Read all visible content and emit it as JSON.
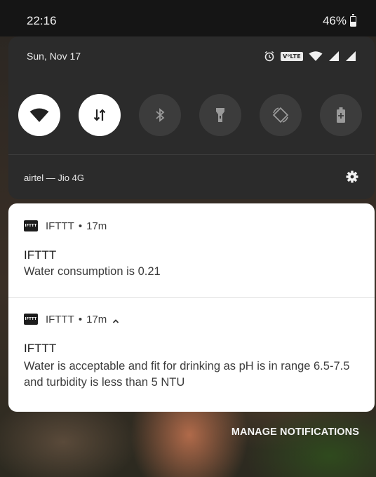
{
  "status_bar": {
    "time": "22:16",
    "battery_percent": "46%",
    "battery_level": 0.46
  },
  "quick_settings": {
    "date": "Sun, Nov 17",
    "volte_badge": "V⁰LTE",
    "toggles": [
      {
        "name": "wifi",
        "icon": "wifi-icon",
        "state": "on"
      },
      {
        "name": "mobile-data",
        "icon": "data-arrows-icon",
        "state": "on"
      },
      {
        "name": "bluetooth",
        "icon": "bluetooth-icon",
        "state": "off"
      },
      {
        "name": "flashlight",
        "icon": "flashlight-icon",
        "state": "off"
      },
      {
        "name": "auto-rotate",
        "icon": "rotate-icon",
        "state": "off"
      },
      {
        "name": "battery-saver",
        "icon": "battery-saver-icon",
        "state": "off"
      }
    ],
    "carrier": "airtel — Jio 4G"
  },
  "notifications": [
    {
      "app_icon_text": "IFTTT",
      "app_name": "IFTTT",
      "separator": "•",
      "time_ago": "17m",
      "title": "IFTTT",
      "text": "Water consumption is 0.21",
      "expanded": false
    },
    {
      "app_icon_text": "IFTTT",
      "app_name": "IFTTT",
      "separator": "•",
      "time_ago": "17m",
      "title": "IFTTT",
      "text": "Water is acceptable and fit for drinking as pH is in range 6.5-7.5 and turbidity is less than 5 NTU",
      "expanded": true
    }
  ],
  "manage_button": "MANAGE NOTIFICATIONS",
  "colors": {
    "panel": "#2b2b2b",
    "toggle_on": "#ffffff",
    "toggle_off": "#3c3c3c",
    "card": "#ffffff"
  }
}
